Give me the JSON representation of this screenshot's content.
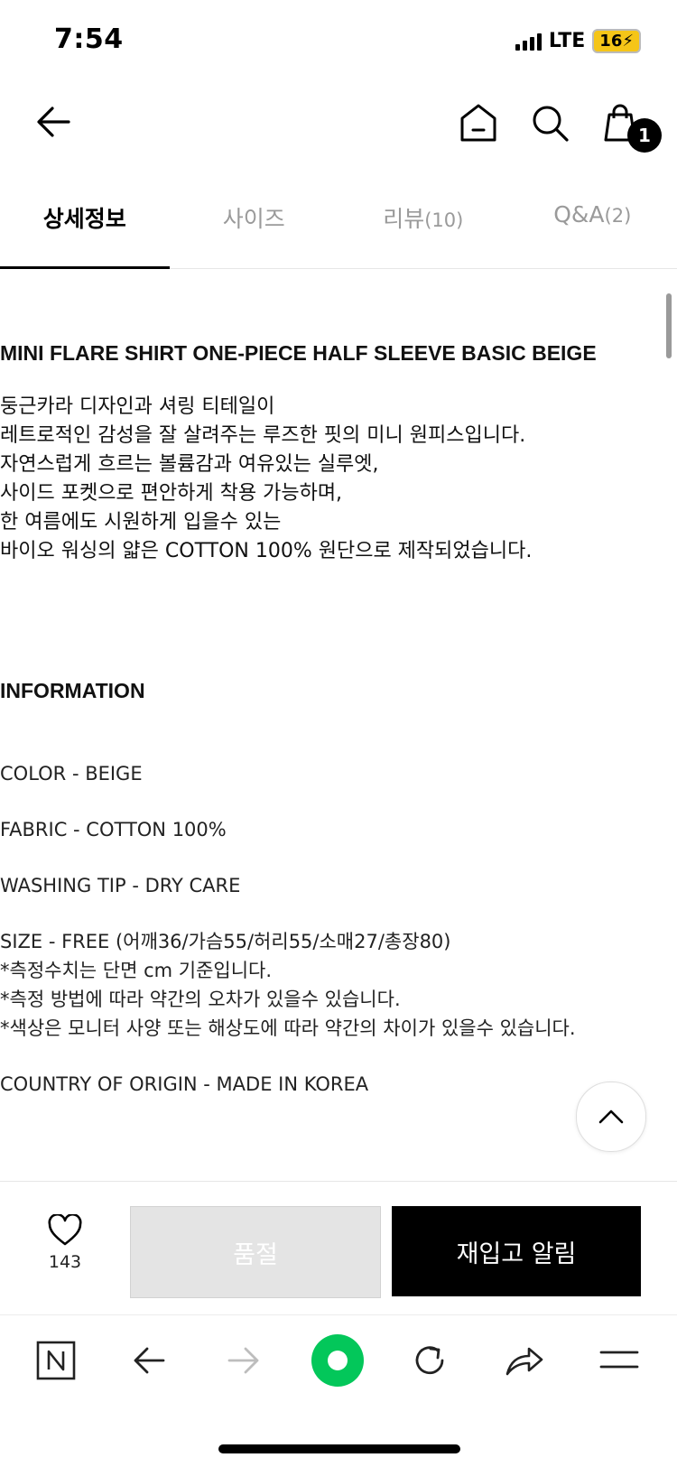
{
  "status_bar": {
    "time": "7:54",
    "network": "LTE",
    "battery": "16"
  },
  "header": {
    "back": "back-arrow-icon",
    "home": "home-icon",
    "search": "search-icon",
    "cart": "shopping-bag-icon",
    "cart_count": "1"
  },
  "tabs": [
    {
      "label": "상세정보",
      "count": ""
    },
    {
      "label": "사이즈",
      "count": ""
    },
    {
      "label": "리뷰",
      "count": "(10)"
    },
    {
      "label": "Q&A",
      "count": "(2)"
    }
  ],
  "product": {
    "title": "MINI FLARE SHIRT ONE-PIECE HALF SLEEVE BASIC BEIGE",
    "description": [
      "둥근카라 디자인과 셔링 티테일이",
      "레트로적인 감성을 잘 살려주는 루즈한 핏의 미니 원피스입니다.",
      "자연스럽게 흐르는 볼륨감과 여유있는 실루엣,",
      "사이드 포켓으로 편안하게 착용 가능하며,",
      "한 여름에도 시원하게 입을수 있는",
      "바이오 워싱의 얇은 COTTON 100% 원단으로 제작되었습니다."
    ],
    "info_title": "INFORMATION",
    "color": "COLOR - BEIGE",
    "fabric": "FABRIC - COTTON 100%",
    "washing": "WASHING TIP - DRY CARE",
    "size": "SIZE - FREE (어깨36/가슴55/허리55/소매27/총장80)",
    "notes": [
      "*측정수치는 단면 cm 기준입니다.",
      "*측정 방법에 따라 약간의 오차가 있을수 있습니다.",
      "*색상은 모니터 사양 또는 해상도에 따라 약간의 차이가 있을수 있습니다."
    ],
    "origin": "COUNTRY OF ORIGIN - MADE IN KOREA"
  },
  "actions": {
    "like_count": "143",
    "soldout_label": "품절",
    "restock_label": "재입고 알림"
  },
  "colors": {
    "accent": "#000000",
    "disabled": "#e4e4e4",
    "naver_green": "#03c75a"
  }
}
